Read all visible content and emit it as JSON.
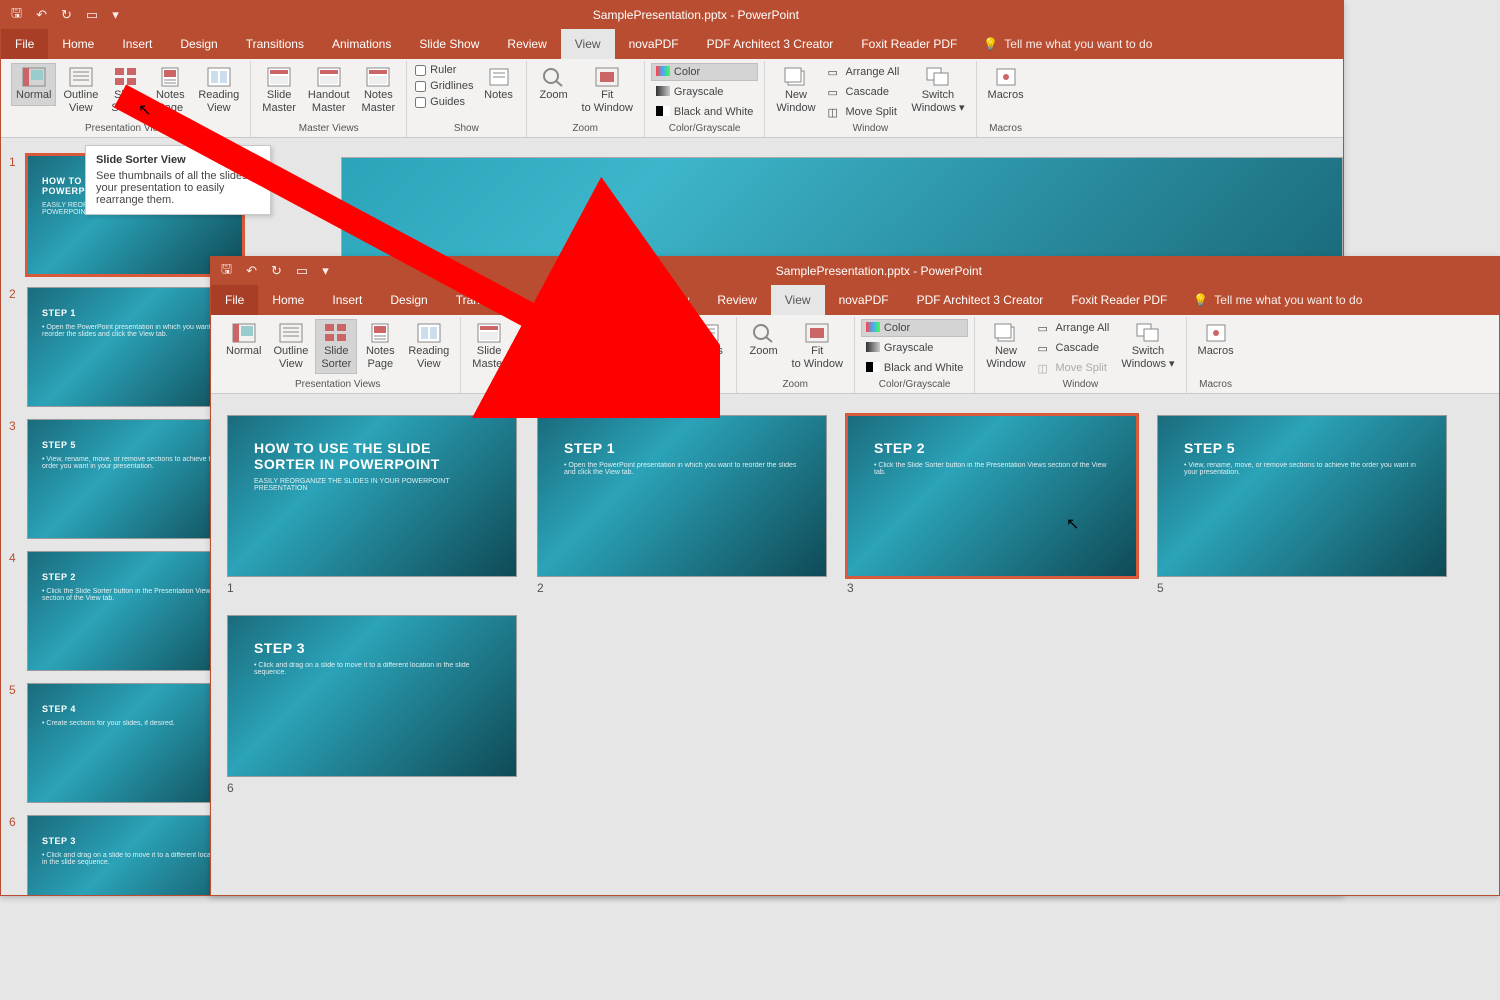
{
  "app_title": "SamplePresentation.pptx - PowerPoint",
  "tellme": "Tell me what you want to do",
  "menus": [
    "File",
    "Home",
    "Insert",
    "Design",
    "Transitions",
    "Animations",
    "Slide Show",
    "Review",
    "View",
    "novaPDF",
    "PDF Architect 3 Creator",
    "Foxit Reader PDF"
  ],
  "active_menu": "View",
  "ribbon": {
    "presentation_views": {
      "label": "Presentation Views",
      "items": [
        "Normal",
        "Outline View",
        "Slide Sorter",
        "Notes Page",
        "Reading View"
      ]
    },
    "master_views": {
      "label": "Master Views",
      "items": [
        "Slide Master",
        "Handout Master",
        "Notes Master"
      ]
    },
    "show": {
      "label": "Show",
      "items": [
        "Ruler",
        "Gridlines",
        "Guides"
      ],
      "notes": "Notes"
    },
    "zoom": {
      "label": "Zoom",
      "zoom": "Zoom",
      "fit": "Fit to Window"
    },
    "color": {
      "label": "Color/Grayscale",
      "color": "Color",
      "gray": "Grayscale",
      "bw": "Black and White"
    },
    "window": {
      "label": "Window",
      "new": "New Window",
      "arrange": "Arrange All",
      "cascade": "Cascade",
      "split": "Move Split",
      "switch": "Switch Windows"
    },
    "macros": {
      "label": "Macros",
      "macros": "Macros"
    }
  },
  "tooltip": {
    "title": "Slide Sorter View",
    "body": "See thumbnails of all the slides in your presentation to easily rearrange them."
  },
  "slides_normal": [
    {
      "n": "1",
      "title": "HOW TO USE THE SLIDE SORTER IN POWERPOINT",
      "sub": "EASILY REORGANIZE THE SLIDES IN YOUR POWERPOINT PRESENTATION",
      "sel": true
    },
    {
      "n": "2",
      "title": "STEP 1",
      "sub": "• Open the PowerPoint presentation in which you want to reorder the slides and click the View tab."
    },
    {
      "n": "3",
      "title": "STEP 5",
      "sub": "• View, rename, move, or remove sections to achieve the order you want in your presentation."
    },
    {
      "n": "4",
      "title": "STEP 2",
      "sub": "• Click the Slide Sorter button in the Presentation Views section of the View tab."
    },
    {
      "n": "5",
      "title": "STEP 4",
      "sub": "• Create sections for your slides, if desired."
    },
    {
      "n": "6",
      "title": "STEP 3",
      "sub": "• Click and drag on a slide to move it to a different location in the slide sequence."
    }
  ],
  "slides_sorter": [
    {
      "n": "1",
      "title": "HOW TO USE THE SLIDE SORTER IN POWERPOINT",
      "sub": "EASILY REORGANIZE THE SLIDES IN YOUR POWERPOINT PRESENTATION"
    },
    {
      "n": "2",
      "title": "STEP 1",
      "sub": "• Open the PowerPoint presentation in which you want to reorder the slides and click the View tab."
    },
    {
      "n": "3",
      "title": "STEP 2",
      "sub": "• Click the Slide Sorter button in the Presentation Views section of the View tab.",
      "sel": true
    },
    {
      "n": "5",
      "title": "STEP 5",
      "sub": "• View, rename, move, or remove sections to achieve the order you want in your presentation."
    },
    {
      "n": "6",
      "title": "STEP 3",
      "sub": "• Click and drag on a slide to move it to a different location in the slide sequence."
    }
  ]
}
